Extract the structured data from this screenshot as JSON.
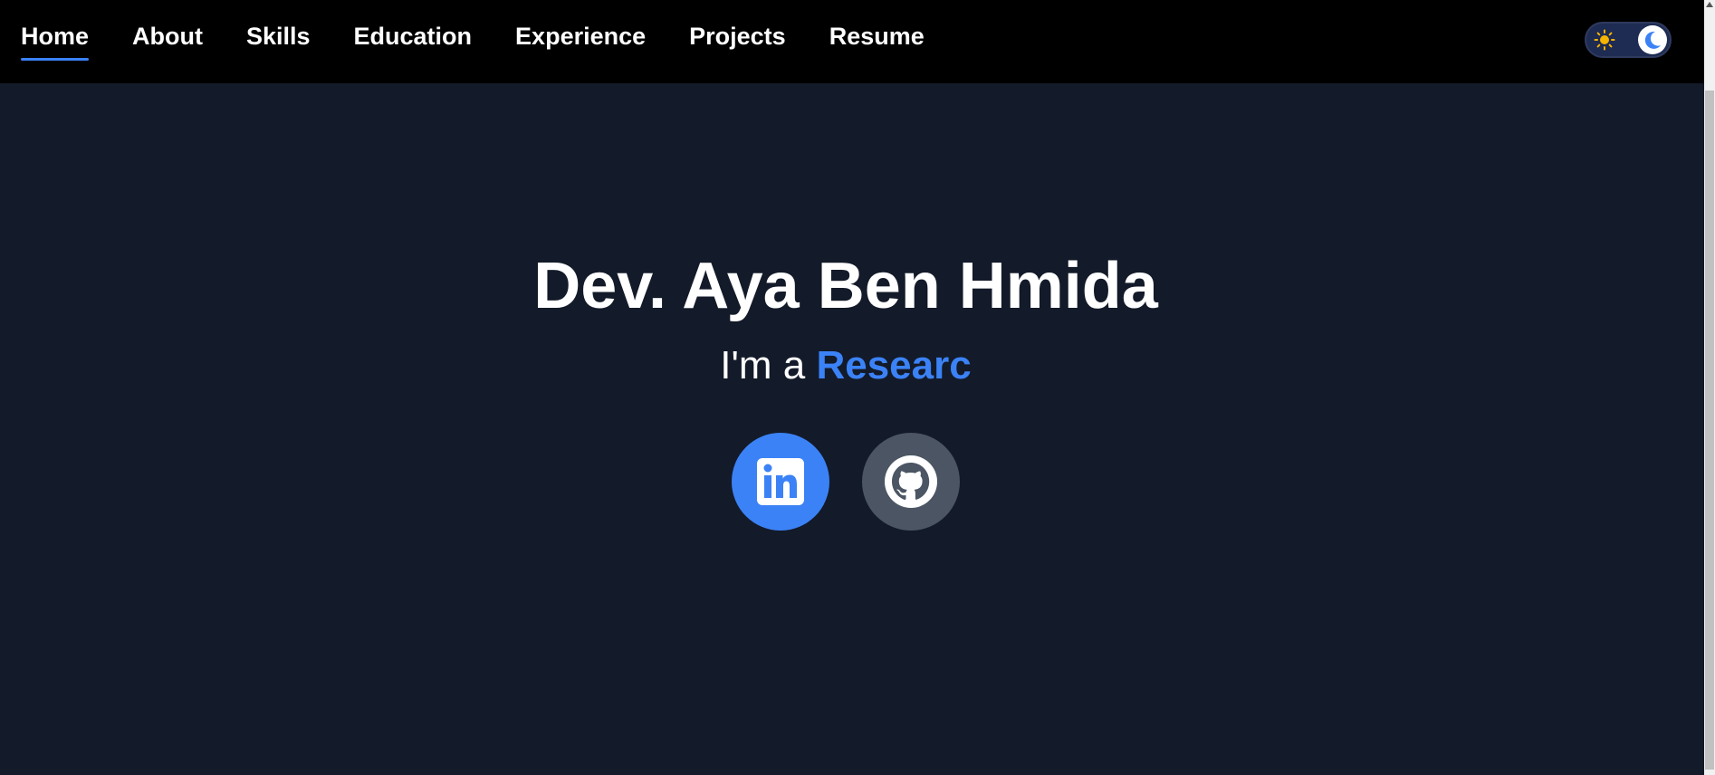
{
  "nav": {
    "links": [
      {
        "label": "Home",
        "active": true
      },
      {
        "label": "About"
      },
      {
        "label": "Skills"
      },
      {
        "label": "Education"
      },
      {
        "label": "Experience"
      },
      {
        "label": "Projects"
      },
      {
        "label": "Resume"
      }
    ],
    "theme_toggle": {
      "mode": "dark",
      "sun_icon": "sun-icon",
      "moon_icon": "moon-icon"
    }
  },
  "hero": {
    "name": "Dev. Aya Ben Hmida",
    "tagline_prefix": "I'm a ",
    "role": "Researc"
  },
  "social": [
    {
      "name": "LinkedIn",
      "icon": "linkedin-icon",
      "color": "#3b82f6"
    },
    {
      "name": "GitHub",
      "icon": "github-icon",
      "color": "#4b5563"
    }
  ],
  "colors": {
    "accent": "#3b82f6",
    "background": "#131a29",
    "navbar": "#000000"
  }
}
